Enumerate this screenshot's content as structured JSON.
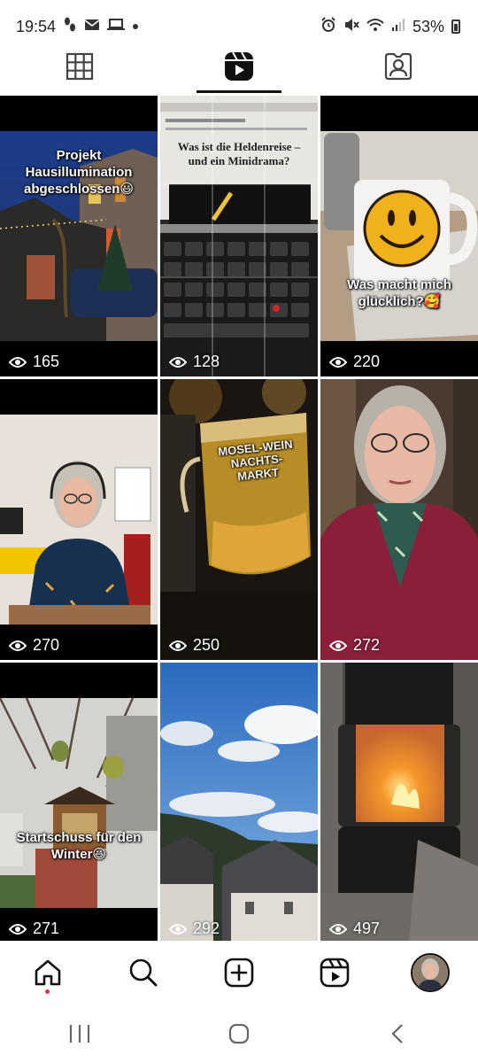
{
  "status_bar": {
    "time": "19:54",
    "battery": "53%",
    "left_icons": [
      "steps-icon",
      "mail-icon",
      "laptop-icon",
      "dot-icon"
    ],
    "right_icons": [
      "alarm-icon",
      "mute-icon",
      "wifi-icon",
      "signal-icon",
      "battery-icon"
    ]
  },
  "tabs": [
    {
      "name": "grid",
      "icon": "grid-icon",
      "active": false
    },
    {
      "name": "reels",
      "icon": "reels-icon",
      "active": true
    },
    {
      "name": "tagged",
      "icon": "tagged-icon",
      "active": false
    }
  ],
  "reels": [
    {
      "caption": "Projekt Hausillumination abgeschlossen😃",
      "views": "165"
    },
    {
      "caption": "",
      "views": "128",
      "screen_title": "Was ist die Heldenreise – und ein Minidrama?"
    },
    {
      "caption": "Was macht mich glücklich?🥰",
      "views": "220"
    },
    {
      "caption": "",
      "views": "270"
    },
    {
      "caption": "",
      "views": "250",
      "mug_text": "MOSEL-WEIN NACHTS-MARKT"
    },
    {
      "caption": "",
      "views": "272"
    },
    {
      "caption": "Startschuss für den Winter😃",
      "views": "271"
    },
    {
      "caption": "",
      "views": "292"
    },
    {
      "caption": "",
      "views": "497"
    }
  ],
  "bottom_nav": [
    "home-icon",
    "search-icon",
    "create-icon",
    "reels-icon",
    "profile-avatar"
  ],
  "system_nav": [
    "recents-icon",
    "home-button-icon",
    "back-icon"
  ],
  "colors": {
    "accent": "#111111",
    "notification": "#ed2e3d",
    "background": "#ffffff"
  }
}
